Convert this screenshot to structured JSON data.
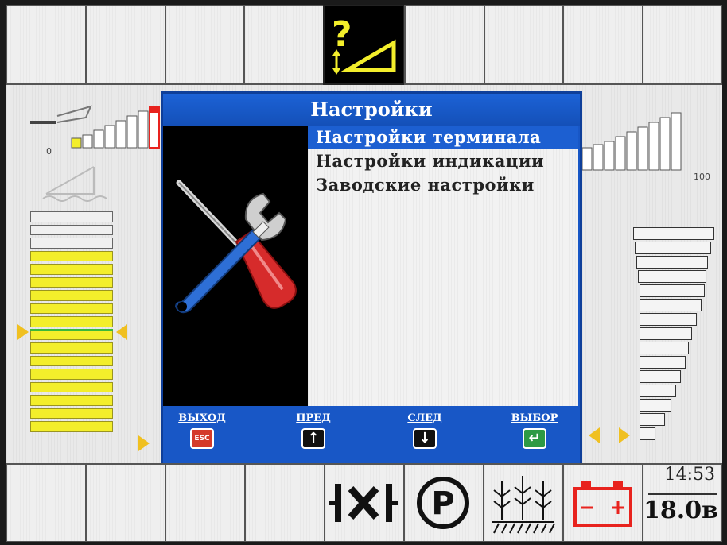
{
  "dialog": {
    "title": "Настройки",
    "menu": [
      {
        "label": "Настройки терминала",
        "selected": true
      },
      {
        "label": "Настройки индикации",
        "selected": false
      },
      {
        "label": "Заводские настройки",
        "selected": false
      }
    ],
    "footer": {
      "exit_label": "ВЫХОД",
      "exit_key": "ESC",
      "prev_label": "ПРЕД",
      "next_label": "СЛЕД",
      "select_label": "ВЫБОР"
    }
  },
  "left_gauge": {
    "scale_min_label": "0"
  },
  "right_gauge": {
    "scale_max_label": "100"
  },
  "status": {
    "time": "14:53",
    "voltage": "18.0в"
  },
  "colors": {
    "dialog_blue": "#1857c6",
    "selected_row": "#1c5fd1",
    "segment_yellow": "#f3ee2b",
    "warn_yellow": "#f3ee2b",
    "battery_red": "#e8231e",
    "esc_red": "#d43a2a",
    "enter_green": "#2d9a45"
  },
  "icons": {
    "top_center": "warning-header-icon",
    "tools": "wrench-screwdriver-icon",
    "b5": "track-lock-icon",
    "b6": "parking-brake-icon",
    "b7": "crop-header-icon",
    "b8": "battery-icon"
  }
}
